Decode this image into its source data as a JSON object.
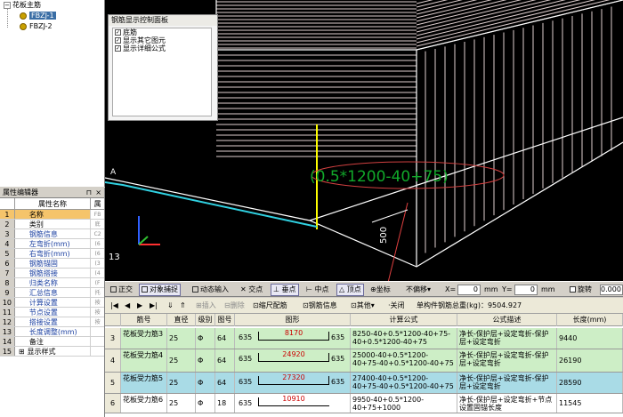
{
  "tree": {
    "root": "花板主筋",
    "children": [
      "FBZJ-1",
      "FBZJ-2"
    ]
  },
  "viewport": {
    "control_panel": {
      "title": "钢筋显示控制面板",
      "items": [
        "底筋",
        "显示其它图元",
        "显示详细公式"
      ]
    },
    "formula_label": "(0.5*1200-40+75)",
    "dimension_label": "500",
    "axis_label": "A",
    "view_number": "13",
    "colors": {
      "formula": "#11a92a",
      "rebar": "#e8d8d8",
      "ellipse": "#d04040",
      "yellow": "#ffff00",
      "cyan": "#30d0e0"
    }
  },
  "property_editor": {
    "title": "属性编辑器",
    "header_name": "属性名称",
    "header_extra": "属",
    "rows": [
      {
        "num": "1",
        "name": "名称",
        "extra": "FB"
      },
      {
        "num": "2",
        "name": "类别",
        "extra": "底"
      },
      {
        "num": "3",
        "name": "钢筋信息",
        "extra": "C2"
      },
      {
        "num": "4",
        "name": "左弯折(mm)",
        "extra": "(6"
      },
      {
        "num": "5",
        "name": "右弯折(mm)",
        "extra": "(6"
      },
      {
        "num": "6",
        "name": "钢筋锚固",
        "extra": "(3"
      },
      {
        "num": "7",
        "name": "钢筋搭接",
        "extra": "(4"
      },
      {
        "num": "8",
        "name": "归类名称",
        "extra": "(F"
      },
      {
        "num": "9",
        "name": "汇总信息",
        "extra": "托"
      },
      {
        "num": "10",
        "name": "计算设置",
        "extra": "按"
      },
      {
        "num": "11",
        "name": "节点设置",
        "extra": "按"
      },
      {
        "num": "12",
        "name": "搭接设置",
        "extra": "按"
      },
      {
        "num": "13",
        "name": "长度调整(mm)",
        "extra": ""
      },
      {
        "num": "14",
        "name": "备注",
        "extra": ""
      },
      {
        "num": "15",
        "name": "显示样式",
        "extra": ""
      }
    ]
  },
  "snap_toolbar": {
    "orthogonal": "正交",
    "object_snap": "对象捕捉",
    "dynamic_input": "动态输入",
    "intersection": "交点",
    "perpendicular": "垂点",
    "midpoint": "中点",
    "vertex": "顶点",
    "coordinate": "坐标",
    "no_offset": "不偏移",
    "x_label": "X=",
    "x_value": "0",
    "mm": "mm",
    "y_label": "Y=",
    "y_value": "0",
    "mm2": "mm",
    "rotate": "旋转",
    "rotate_value": "0.000"
  },
  "grid_toolbar": {
    "insert": "插入",
    "delete": "删除",
    "scale_rebar": "缩尺配筋",
    "rebar_info": "钢筋信息",
    "other": "其他",
    "close": "关闭",
    "total_weight": "单构件钢筋总重(kg)：9504.927"
  },
  "grid": {
    "headers": [
      "筋号",
      "直径(mm)",
      "级别",
      "图号",
      "图形",
      "计算公式",
      "公式描述",
      "长度(mm)"
    ],
    "rows": [
      {
        "rn": "3",
        "name": "花板受力筋3",
        "dia": "25",
        "grade": "Φ",
        "fig": "64",
        "left": "635",
        "mid": "8170",
        "right": "635",
        "formula": "8250-40+0.5*1200-40+75-40+0.5*1200-40+75",
        "desc": "净长-保护层+设定弯折-保护层+设定弯折",
        "len": "9440"
      },
      {
        "rn": "4",
        "name": "花板受力筋4",
        "dia": "25",
        "grade": "Φ",
        "fig": "64",
        "left": "635",
        "mid": "24920",
        "right": "635",
        "formula": "25000-40+0.5*1200-40+75-40+0.5*1200-40+75",
        "desc": "净长-保护层+设定弯折-保护层+设定弯折",
        "len": "26190"
      },
      {
        "rn": "5",
        "name": "花板受力筋5",
        "dia": "25",
        "grade": "Φ",
        "fig": "64",
        "left": "635",
        "mid": "27320",
        "right": "635",
        "formula": "27400-40+0.5*1200-40+75-40+0.5*1200-40+75",
        "desc": "净长-保护层+设定弯折-保护层+设定弯折",
        "len": "28590"
      },
      {
        "rn": "6",
        "name": "花板受力筋6",
        "dia": "25",
        "grade": "Φ",
        "fig": "18",
        "left": "635",
        "mid": "10910",
        "right": "",
        "formula": "9950-40+0.5*1200-40+75+1000",
        "desc": "净长-保护层+设定弯折+节点设置固锚长度",
        "len": "11545"
      }
    ]
  }
}
